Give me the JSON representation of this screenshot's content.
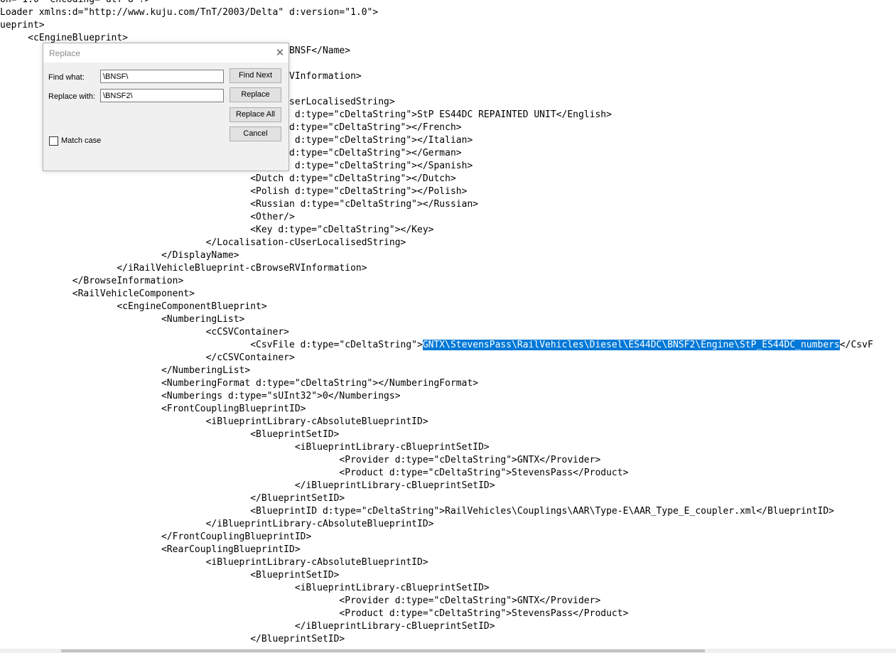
{
  "editor": {
    "lines": [
      "on=\"1.0\" encoding=\"utf-8\"?>",
      "Loader xmlns:d=\"http://www.kuju.com/TnT/2003/Delta\" d:version=\"1.0\">",
      "ueprint>",
      "     <cEngineBlueprint>",
      "                                                  C BNSF</Name>",
      "",
      "                                                  eRVInformation>",
      "",
      "                                                 -cUserLocalisedString>",
      "                                                 ish d:type=\"cDeltaString\">StP ES44DC REPAINTED UNIT</English>",
      "                                                 ch d:type=\"cDeltaString\"></French>",
      "                                                 ian d:type=\"cDeltaString\"></Italian>",
      "                                                 an d:type=\"cDeltaString\"></German>",
      "                                                 ish d:type=\"cDeltaString\"></Spanish>",
      "                                             <Dutch d:type=\"cDeltaString\"></Dutch>",
      "                                             <Polish d:type=\"cDeltaString\"></Polish>",
      "                                             <Russian d:type=\"cDeltaString\"></Russian>",
      "                                             <Other/>",
      "                                             <Key d:type=\"cDeltaString\"></Key>",
      "                                     </Localisation-cUserLocalisedString>",
      "                             </DisplayName>",
      "                     </iRailVehicleBlueprint-cBrowseRVInformation>",
      "             </BrowseInformation>",
      "             <RailVehicleComponent>",
      "                     <cEngineComponentBlueprint>",
      "                             <NumberingList>",
      "                                     <cCSVContainer>",
      "                                             <CsvFile d:type=\"cDeltaString\">",
      "                                     </cCSVContainer>",
      "                             </NumberingList>",
      "                             <NumberingFormat d:type=\"cDeltaString\"></NumberingFormat>",
      "                             <Numberings d:type=\"sUInt32\">0</Numberings>",
      "                             <FrontCouplingBlueprintID>",
      "                                     <iBlueprintLibrary-cAbsoluteBlueprintID>",
      "                                             <BlueprintSetID>",
      "                                                     <iBlueprintLibrary-cBlueprintSetID>",
      "                                                             <Provider d:type=\"cDeltaString\">GNTX</Provider>",
      "                                                             <Product d:type=\"cDeltaString\">StevensPass</Product>",
      "                                                     </iBlueprintLibrary-cBlueprintSetID>",
      "                                             </BlueprintSetID>",
      "                                             <BlueprintID d:type=\"cDeltaString\">RailVehicles\\Couplings\\AAR\\Type-E\\AAR_Type_E_coupler.xml</BlueprintID>",
      "                                     </iBlueprintLibrary-cAbsoluteBlueprintID>",
      "                             </FrontCouplingBlueprintID>",
      "                             <RearCouplingBlueprintID>",
      "                                     <iBlueprintLibrary-cAbsoluteBlueprintID>",
      "                                             <BlueprintSetID>",
      "                                                     <iBlueprintLibrary-cBlueprintSetID>",
      "                                                             <Provider d:type=\"cDeltaString\">GNTX</Provider>",
      "                                                             <Product d:type=\"cDeltaString\">StevensPass</Product>",
      "                                                     </iBlueprintLibrary-cBlueprintSetID>",
      "                                             </BlueprintSetID>"
    ],
    "selection": {
      "line_index": 27,
      "text": "GNTX\\StevensPass\\RailVehicles\\Diesel\\ES44DC\\BNSF2\\Engine\\StP_ES44DC_numbers",
      "after": "</CsvF"
    },
    "selection_color": "#0078d7"
  },
  "replace_dialog": {
    "title": "Replace",
    "find_label": "Find what:",
    "find_value": "\\BNSF\\",
    "replace_label": "Replace with:",
    "replace_value": "\\BNSF2\\",
    "match_case_label": "Match case",
    "match_case_checked": false,
    "buttons": {
      "find_next": "Find Next",
      "replace": "Replace",
      "replace_all": "Replace All",
      "cancel": "Cancel"
    },
    "close_icon": "close-icon"
  }
}
